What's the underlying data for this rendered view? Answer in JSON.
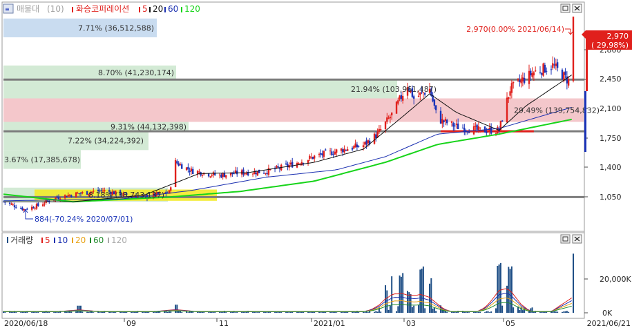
{
  "colors": {
    "up": "#e0201c",
    "down": "#1a33b8",
    "ma5": "#e0201c",
    "ma20": "#111111",
    "ma60": "#1a2fb0",
    "ma120": "#17d41a",
    "vol_ma5": "#e0201c",
    "vol_ma10": "#1a2fb0",
    "vol_ma20": "#e8a317",
    "vol_ma60": "#1f8a2a",
    "vol_ma120": "#aaaaaa",
    "band_blue": "#c9dcf0",
    "band_green": "#d3ead5",
    "band_pink": "#f4c7cb",
    "band_yellow": "#f3ea2a",
    "hline": "#7c7c7c",
    "support": "#e0201c",
    "price_box": "#e0201c",
    "volume_bar": "#1f4f86"
  },
  "price_panel": {
    "legend": {
      "lead": "매물대",
      "lead_count": "(10)",
      "indicator": "화승코퍼레이션",
      "ma": [
        "5",
        "20",
        "60",
        "120"
      ]
    },
    "window_buttons": [
      "restore-button",
      "close-button"
    ],
    "price_axis_labels": [
      "2,800",
      "2,450",
      "2,100",
      "1,750",
      "1,400",
      "1,050"
    ],
    "current_price_box": {
      "price": "2,970",
      "change": "( 29.98%)"
    },
    "annotations": {
      "high": "2,970(0.00% 2021/06/14)",
      "low": "884(-70.24% 2020/07/01)"
    },
    "volume_profile_labels": [
      "7.71% (36,512,588)",
      "8.70% (41,230,174)",
      "21.94% (103,961,487)",
      "29.49% (139,754,832)",
      "9.31% (44,132,398)",
      "7.22% (34,224,392)",
      "3.67% (17,385,678)",
      "8.18% (38,743,137)"
    ]
  },
  "volume_panel": {
    "legend": {
      "lead": "거래량",
      "ma": [
        "5",
        "10",
        "20",
        "60",
        "120"
      ]
    },
    "window_buttons": [
      "restore-button",
      "close-button"
    ],
    "axis_labels": [
      "20,000K",
      "0K"
    ]
  },
  "x_axis_labels": [
    "2020/06/18",
    "09",
    "11",
    "2021/01",
    "03",
    "05",
    "2021/06/21"
  ],
  "chart_data": {
    "type": "candlestick",
    "title": "화승코퍼레이션",
    "x_range": [
      "2020/06/18",
      "2021/06/21"
    ],
    "y_range": [
      700,
      3000
    ],
    "high": {
      "price": 2970,
      "change_pct": 0.0,
      "date": "2021/06/14"
    },
    "low": {
      "price": 884,
      "change_pct": -70.24,
      "date": "2020/07/01"
    },
    "last_price": 2970,
    "last_change_pct": 29.98,
    "horizontal_lines": [
      2300,
      1750,
      1050
    ],
    "support_segment": {
      "price": 1750,
      "from": "2021/03",
      "to": "2021/05"
    },
    "volume_profile": [
      {
        "price_from": 2750,
        "price_to": 2950,
        "pct": 7.71,
        "volume": 36512588
      },
      {
        "price_from": 2300,
        "price_to": 2450,
        "pct": 8.7,
        "volume": 41230174
      },
      {
        "price_from": 2100,
        "price_to": 2300,
        "pct": 21.94,
        "volume": 103961487
      },
      {
        "price_from": 1850,
        "price_to": 2100,
        "pct": 29.49,
        "volume": 139754832
      },
      {
        "price_from": 1750,
        "price_to": 1850,
        "pct": 9.31,
        "volume": 44132398
      },
      {
        "price_from": 1550,
        "price_to": 1750,
        "pct": 7.22,
        "volume": 34224392
      },
      {
        "price_from": 1350,
        "price_to": 1550,
        "pct": 3.67,
        "volume": 17385678
      },
      {
        "price_from": 1000,
        "price_to": 1150,
        "pct": 8.18,
        "volume": 38743137
      }
    ],
    "price_keypoints": [
      [
        "2020/06/18",
        1000
      ],
      [
        "2020/07/01",
        920
      ],
      [
        "2020/07/10",
        960
      ],
      [
        "2020/07/20",
        1040
      ],
      [
        "2020/08/01",
        1080
      ],
      [
        "2020/08/20",
        1120
      ],
      [
        "2020/09/01",
        1080
      ],
      [
        "2020/09/15",
        1050
      ],
      [
        "2020/10/01",
        1100
      ],
      [
        "2020/10/05",
        1420
      ],
      [
        "2020/10/15",
        1330
      ],
      [
        "2020/11/01",
        1280
      ],
      [
        "2020/11/15",
        1310
      ],
      [
        "2020/12/01",
        1320
      ],
      [
        "2020/12/15",
        1380
      ],
      [
        "2021/01/01",
        1480
      ],
      [
        "2021/01/20",
        1560
      ],
      [
        "2021/02/01",
        1600
      ],
      [
        "2021/02/10",
        1720
      ],
      [
        "2021/02/20",
        1950
      ],
      [
        "2021/03/01",
        2250
      ],
      [
        "2021/03/05",
        2100
      ],
      [
        "2021/03/15",
        2200
      ],
      [
        "2021/03/20",
        1880
      ],
      [
        "2021/04/01",
        1800
      ],
      [
        "2021/04/15",
        1760
      ],
      [
        "2021/04/28",
        1760
      ],
      [
        "2021/05/05",
        2200
      ],
      [
        "2021/05/20",
        2380
      ],
      [
        "2021/06/01",
        2450
      ],
      [
        "2021/06/11",
        2285
      ],
      [
        "2021/06/14",
        2970
      ]
    ],
    "ma20_keypoints": [
      [
        "2020/06/18",
        1000
      ],
      [
        "2020/08/01",
        1000
      ],
      [
        "2020/09/15",
        1070
      ],
      [
        "2020/10/20",
        1300
      ],
      [
        "2020/11/20",
        1310
      ],
      [
        "2021/01/01",
        1420
      ],
      [
        "2021/02/01",
        1560
      ],
      [
        "2021/03/01",
        1950
      ],
      [
        "2021/03/15",
        2150
      ],
      [
        "2021/04/01",
        1950
      ],
      [
        "2021/04/28",
        1760
      ],
      [
        "2021/05/15",
        2020
      ],
      [
        "2021/06/14",
        2360
      ]
    ],
    "ma60_keypoints": [
      [
        "2020/06/18",
        1010
      ],
      [
        "2020/09/01",
        1030
      ],
      [
        "2020/10/15",
        1120
      ],
      [
        "2020/12/01",
        1260
      ],
      [
        "2021/01/15",
        1340
      ],
      [
        "2021/02/15",
        1480
      ],
      [
        "2021/03/20",
        1720
      ],
      [
        "2021/04/28",
        1780
      ],
      [
        "2021/06/14",
        2010
      ]
    ],
    "ma120_keypoints": [
      [
        "2020/06/18",
        1080
      ],
      [
        "2020/08/01",
        1000
      ],
      [
        "2020/10/01",
        1050
      ],
      [
        "2020/11/15",
        1110
      ],
      [
        "2021/01/01",
        1220
      ],
      [
        "2021/02/15",
        1420
      ],
      [
        "2021/03/20",
        1610
      ],
      [
        "2021/04/28",
        1720
      ],
      [
        "2021/06/14",
        1880
      ]
    ],
    "volume_spikes_k": [
      [
        "2020/08/05",
        4200
      ],
      [
        "2020/10/05",
        4800
      ],
      [
        "2021/02/15",
        13000
      ],
      [
        "2021/02/20",
        18000
      ],
      [
        "2021/02/25",
        20500
      ],
      [
        "2021/03/02",
        9500
      ],
      [
        "2021/03/10",
        25000
      ],
      [
        "2021/03/15",
        17000
      ],
      [
        "2021/04/28",
        26000
      ],
      [
        "2021/05/02",
        16000
      ],
      [
        "2021/05/05",
        25000
      ],
      [
        "2021/06/14",
        35000
      ]
    ]
  }
}
